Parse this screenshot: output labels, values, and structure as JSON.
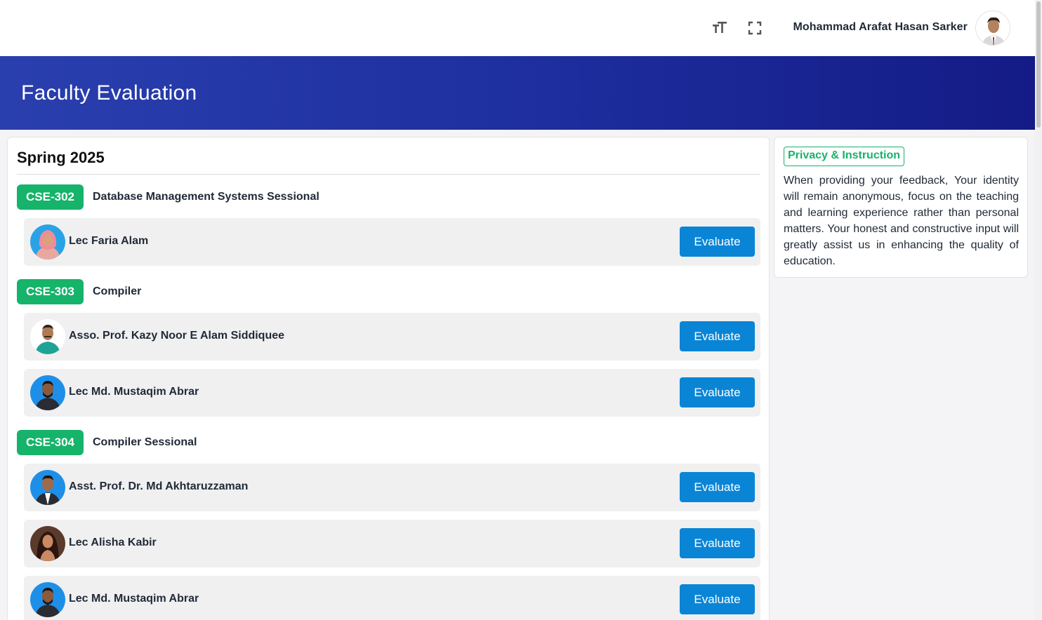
{
  "header": {
    "font_size_icon": "text-size-icon",
    "fullscreen_icon": "fullscreen-icon",
    "user_name": "Mohammad Arafat Hasan Sarker"
  },
  "banner": {
    "title": "Faculty Evaluation"
  },
  "main": {
    "semester": "Spring 2025",
    "courses": [
      {
        "code": "CSE-302",
        "title": "Database Management Systems Sessional",
        "faculty": [
          {
            "name": "Lec Faria Alam",
            "button": "Evaluate"
          }
        ]
      },
      {
        "code": "CSE-303",
        "title": "Compiler",
        "faculty": [
          {
            "name": "Asso. Prof. Kazy Noor E Alam Siddiquee",
            "button": "Evaluate"
          },
          {
            "name": "Lec Md. Mustaqim Abrar",
            "button": "Evaluate"
          }
        ]
      },
      {
        "code": "CSE-304",
        "title": "Compiler Sessional",
        "faculty": [
          {
            "name": "Asst. Prof. Dr. Md Akhtaruzzaman",
            "button": "Evaluate"
          },
          {
            "name": "Lec Alisha Kabir",
            "button": "Evaluate"
          },
          {
            "name": "Lec Md. Mustaqim Abrar",
            "button": "Evaluate"
          }
        ]
      }
    ]
  },
  "sidebar": {
    "tag": "Privacy & Instruction",
    "text": "When providing your feedback, Your identity will remain anonymous, focus on the teaching and learning experience rather than personal matters. Your honest and constructive input will greatly assist us in enhancing the quality of education."
  },
  "colors": {
    "brand_banner": "#1e2f9f",
    "badge_green": "#16b36a",
    "button_blue": "#0a85d6"
  }
}
